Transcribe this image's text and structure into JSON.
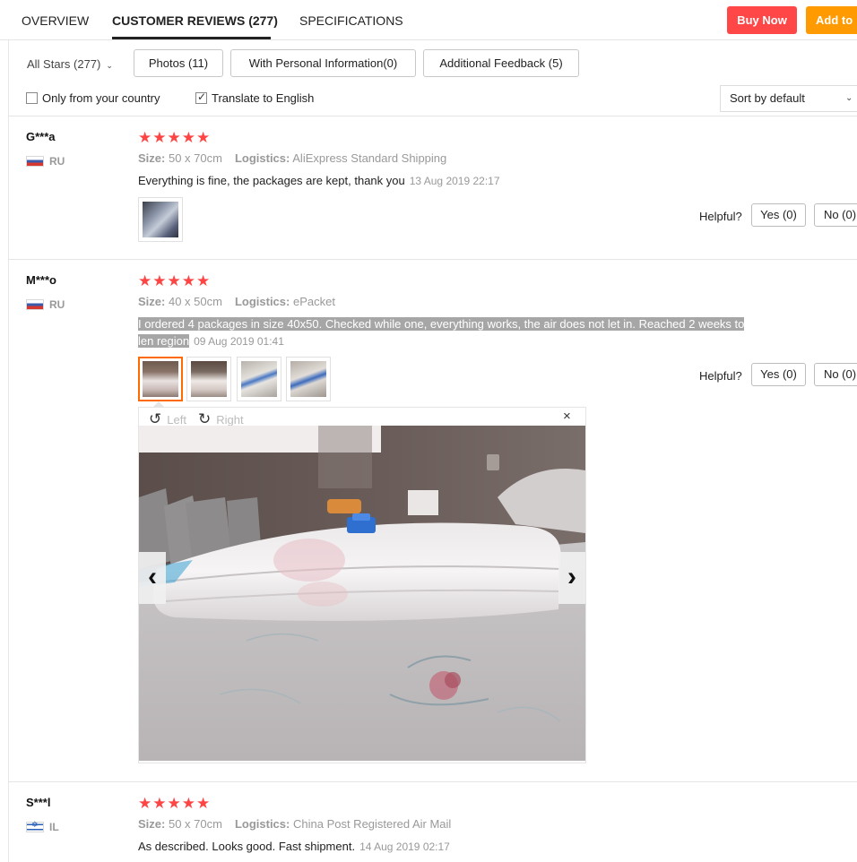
{
  "tabs": {
    "overview": "OVERVIEW",
    "reviews": "CUSTOMER REVIEWS (277)",
    "specs": "SPECIFICATIONS"
  },
  "actions": {
    "buy_now": "Buy Now",
    "add_to": "Add to"
  },
  "filters": {
    "star_select": "All Stars (277)",
    "photos": "Photos (11)",
    "personal": "With Personal Information(0)",
    "additional": "Additional Feedback (5)",
    "only_country": "Only from your country",
    "only_country_checked": false,
    "translate": "Translate to English",
    "translate_checked": true,
    "sort": "Sort by default"
  },
  "reviews": [
    {
      "user": "G***a",
      "country": "RU",
      "rating": 5,
      "size_label": "Size:",
      "size": "50 x 70cm",
      "logistics_label": "Logistics:",
      "logistics": "AliExpress Standard Shipping",
      "text": "Everything is fine, the packages are kept, thank you",
      "date": "13 Aug 2019 22:17",
      "helpful_label": "Helpful?",
      "yes": "Yes (0)",
      "no": "No (0)"
    },
    {
      "user": "M***o",
      "country": "RU",
      "rating": 5,
      "size_label": "Size:",
      "size": "40 x 50cm",
      "logistics_label": "Logistics:",
      "logistics": "ePacket",
      "text_line1": "I ordered 4 packages in size 40x50. Checked while one, everything works, the air does not let in. Reached 2 weeks to",
      "text_line2": "len region",
      "date": "09 Aug 2019 01:41",
      "helpful_label": "Helpful?",
      "yes": "Yes (0)",
      "no": "No (0)",
      "viewer": {
        "rotate_left": "Left",
        "rotate_right": "Right",
        "close": "×"
      }
    },
    {
      "user": "S***l",
      "country": "IL",
      "rating": 5,
      "size_label": "Size:",
      "size": "50 x 70cm",
      "logistics_label": "Logistics:",
      "logistics": "China Post Registered Air Mail",
      "text": "As described. Looks good. Fast shipment.",
      "date": "14 Aug 2019 02:17"
    }
  ],
  "icons": {
    "star": "★",
    "chevron_down": "⌄",
    "prev": "‹",
    "next": "›",
    "rotate_left": "↺",
    "rotate_right": "↻"
  },
  "colors": {
    "buy_now": "#ff4747",
    "add_to": "#ff9a00",
    "star": "#ff4444",
    "selected_thumb": "#ff6a00"
  }
}
